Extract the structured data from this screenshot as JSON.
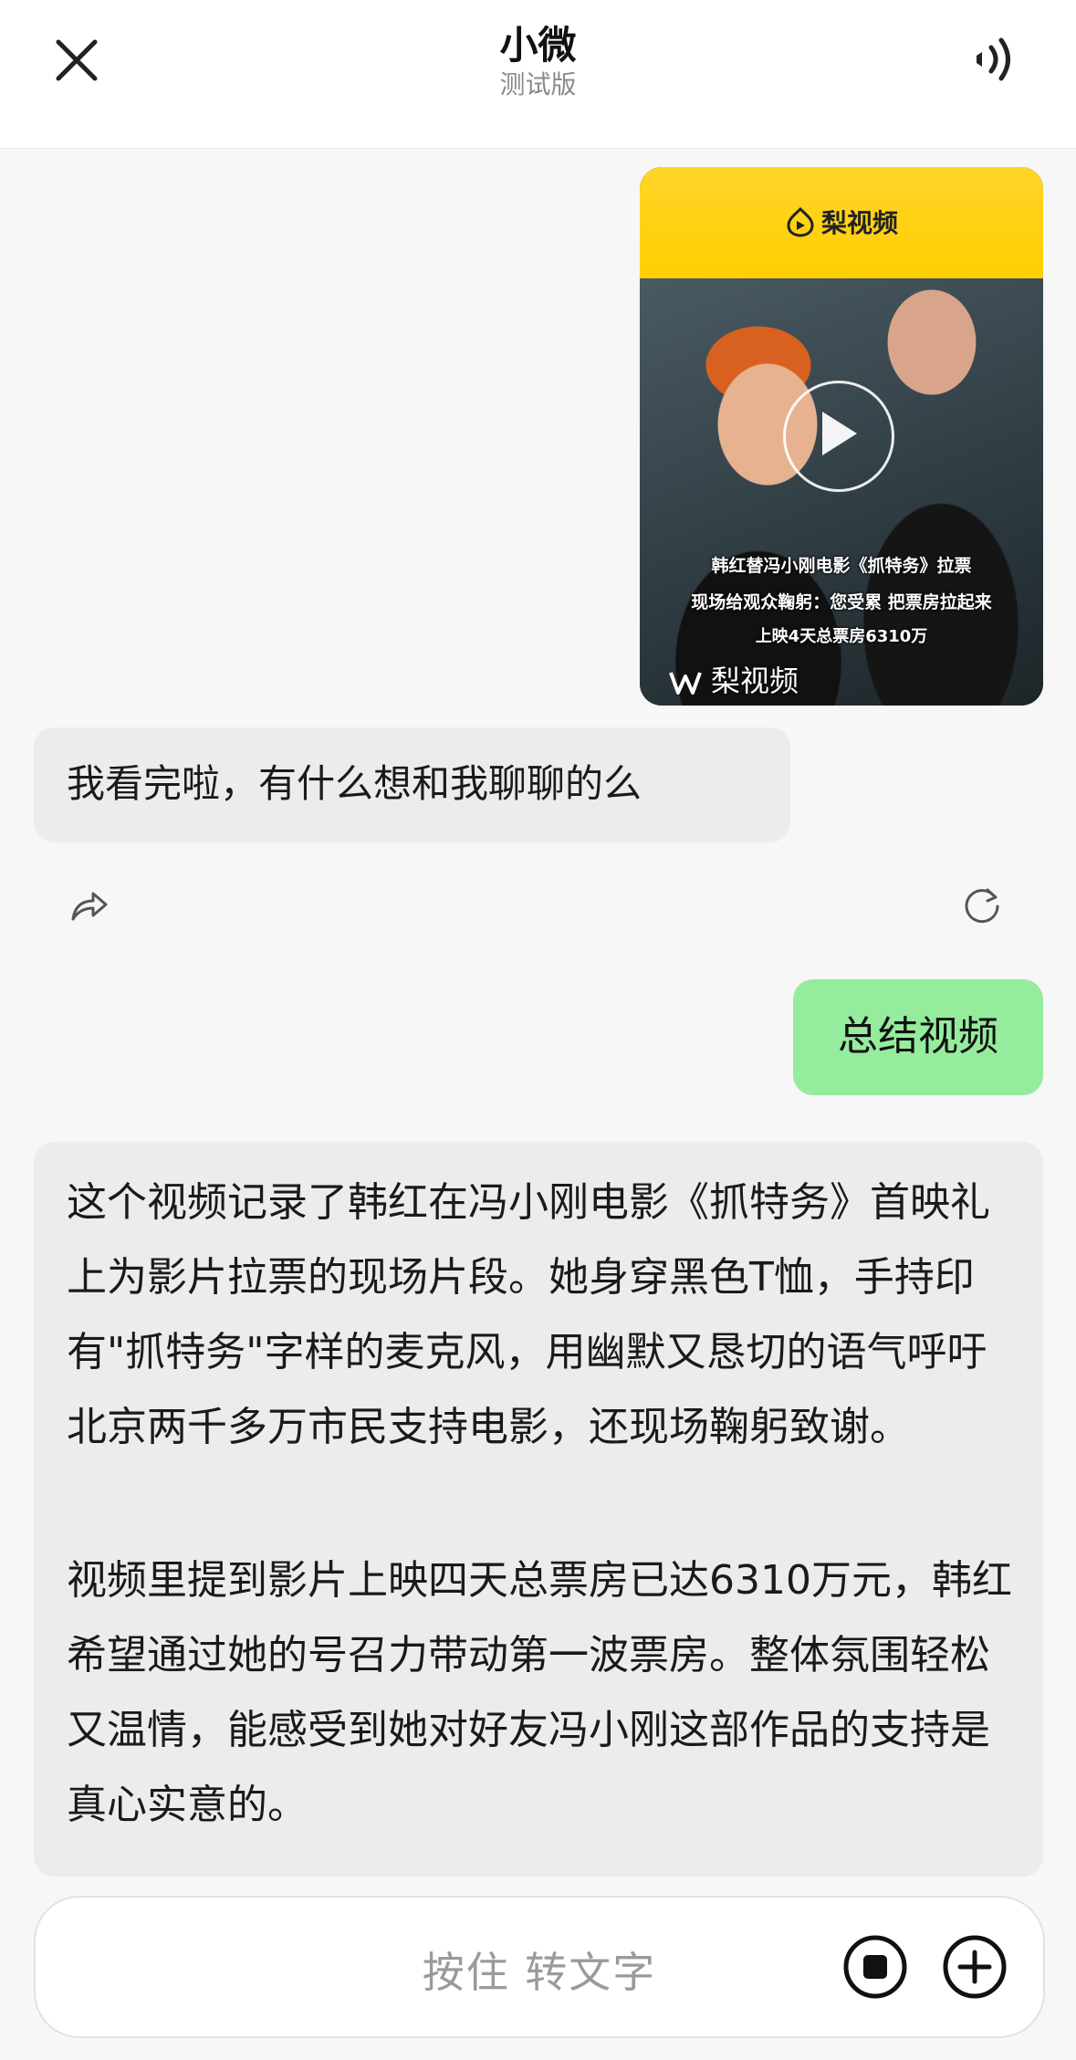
{
  "header": {
    "title": "小微",
    "subtitle": "测试版",
    "close_icon": "close-icon",
    "speaker_icon": "speaker-icon"
  },
  "video_card": {
    "brand_top": "梨视频",
    "caption_line1": "韩红替冯小刚电影《抓特务》拉票",
    "caption_line2": "现场给观众鞠躬：您受累 把票房拉起来",
    "caption_line3": "上映4天总票房6310万",
    "brand_bottom": "梨视频",
    "play_icon": "play-icon"
  },
  "messages": {
    "bot_1": "我看完啦，有什么想和我聊聊的么",
    "user_1": "总结视频",
    "bot_2_p1": "这个视频记录了韩红在冯小刚电影《抓特务》首映礼上为影片拉票的现场片段。她身穿黑色T恤，手持印有\"抓特务\"字样的麦克风，用幽默又恳切的语气呼吁北京两千多万市民支持电影，还现场鞠躬致谢。",
    "bot_2_p2": "视频里提到影片上映四天总票房已达6310万元，韩红希望通过她的号召力带动第一波票房。整体氛围轻松又温情，能感受到她对好友冯小刚这部作品的支持是真心实意的。"
  },
  "actions": {
    "share_icon": "share-icon",
    "refresh_icon": "refresh-icon"
  },
  "input": {
    "hint": "按住 转文字",
    "stop_icon": "stop-icon",
    "plus_icon": "plus-icon"
  },
  "colors": {
    "user_bubble": "#95ec9d",
    "bot_bubble": "#ececec",
    "brand_yellow": "#ffd42a"
  }
}
